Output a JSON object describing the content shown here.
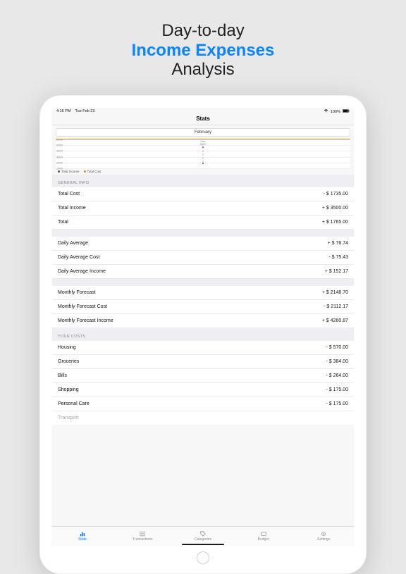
{
  "headline": {
    "line1": "Day-to-day",
    "line2": "Income Expenses",
    "line3": "Analysis"
  },
  "status": {
    "time": "4:16 PM",
    "date": "Tue Feb 23",
    "wifi": "wifi",
    "battery": "100%"
  },
  "nav": {
    "title": "Stats"
  },
  "monthPicker": {
    "label": "February"
  },
  "chart": {
    "top_label_1": "Feb",
    "top_label_2": "8800",
    "legend_income": "Total Income",
    "legend_cost": "Total Cost"
  },
  "chart_data": {
    "type": "line",
    "xlabel": "",
    "ylabel": "",
    "ylim": [
      1000,
      6000
    ],
    "y_ticks": [
      "6000",
      "5000",
      "4000",
      "3000",
      "2000",
      "1000"
    ],
    "x_labels": [
      "Feb"
    ],
    "series": [
      {
        "name": "Total Income",
        "values": [
          3500
        ]
      },
      {
        "name": "Total Cost",
        "values": [
          1735
        ]
      }
    ],
    "legend_position": "bottom-left",
    "accent_border": "#e6852a"
  },
  "sections": {
    "general": {
      "header": "GENERAL INFO",
      "rows": [
        {
          "label": "Total Cost",
          "value": "- $ 1735.00"
        },
        {
          "label": "Total Income",
          "value": "+ $ 3500.00"
        },
        {
          "label": "Total",
          "value": "+ $ 1765.00"
        }
      ]
    },
    "daily": {
      "rows": [
        {
          "label": "Daily Average",
          "value": "+ $ 76.74"
        },
        {
          "label": "Daily Average Cost",
          "value": "- $ 75.43"
        },
        {
          "label": "Daily Average Income",
          "value": "+ $ 152.17"
        }
      ]
    },
    "monthly": {
      "rows": [
        {
          "label": "Monthly Forecast",
          "value": "+ $ 2148.70"
        },
        {
          "label": "Monthly Forecast Cost",
          "value": "- $ 2112.17"
        },
        {
          "label": "Monthly Forecast Income",
          "value": "+ $ 4260.87"
        }
      ]
    },
    "costs": {
      "header": "YOUR COSTS",
      "rows": [
        {
          "label": "Housing",
          "value": "- $ 570.00"
        },
        {
          "label": "Groceries",
          "value": "- $ 384.00"
        },
        {
          "label": "Bills",
          "value": "- $ 264.00"
        },
        {
          "label": "Shopping",
          "value": "- $ 175.00"
        },
        {
          "label": "Personal Care",
          "value": "- $ 175.00"
        },
        {
          "label": "Transport",
          "value": ""
        }
      ]
    }
  },
  "tabs": {
    "items": [
      {
        "label": "Stats",
        "icon": "chart-bar"
      },
      {
        "label": "Transactions",
        "icon": "list"
      },
      {
        "label": "Categories",
        "icon": "tag"
      },
      {
        "label": "Budget",
        "icon": "wallet"
      },
      {
        "label": "Settings",
        "icon": "gear"
      }
    ]
  }
}
